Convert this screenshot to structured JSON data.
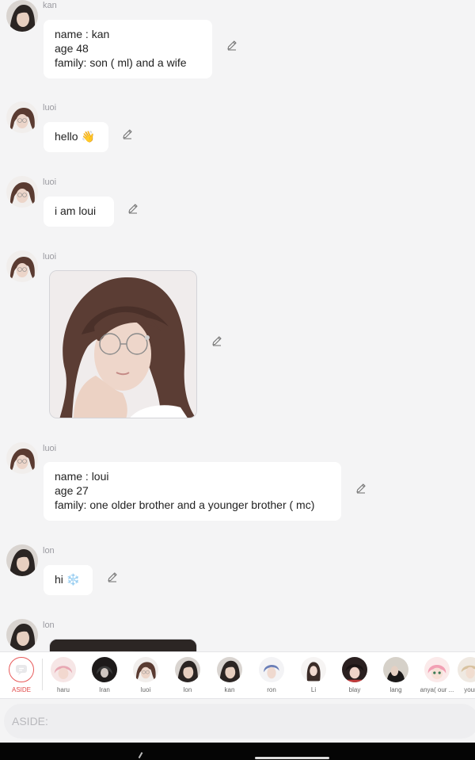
{
  "feed": {
    "messages": [
      {
        "sender": "kan",
        "lines": [
          "name : kan",
          "age 48",
          "family: son ( ml) and a wife"
        ]
      },
      {
        "sender": "luoi",
        "text": "hello",
        "emoji": "👋"
      },
      {
        "sender": "luoi",
        "text": "i am loui"
      },
      {
        "sender": "luoi",
        "image": "portrait"
      },
      {
        "sender": "luoi",
        "lines": [
          "name : loui",
          "age 27",
          "family: one older brother and a younger brother ( mc)"
        ]
      },
      {
        "sender": "lon",
        "text": "hi",
        "emoji": "❄️"
      },
      {
        "sender": "lon",
        "image": "portrait-partial"
      }
    ]
  },
  "charbar": {
    "items": [
      {
        "label": "ASIDE",
        "active": true
      },
      {
        "label": "haru"
      },
      {
        "label": "Iran"
      },
      {
        "label": "luoi"
      },
      {
        "label": "lon"
      },
      {
        "label": "kan"
      },
      {
        "label": "ron"
      },
      {
        "label": "Li"
      },
      {
        "label": "blay"
      },
      {
        "label": "lang"
      },
      {
        "label": "anya( our ..."
      },
      {
        "label": "your"
      }
    ]
  },
  "input": {
    "placeholder": "ASIDE:"
  },
  "colors": {
    "accent": "#e04848",
    "bubble": "#ffffff",
    "background": "#f4f4f5"
  }
}
